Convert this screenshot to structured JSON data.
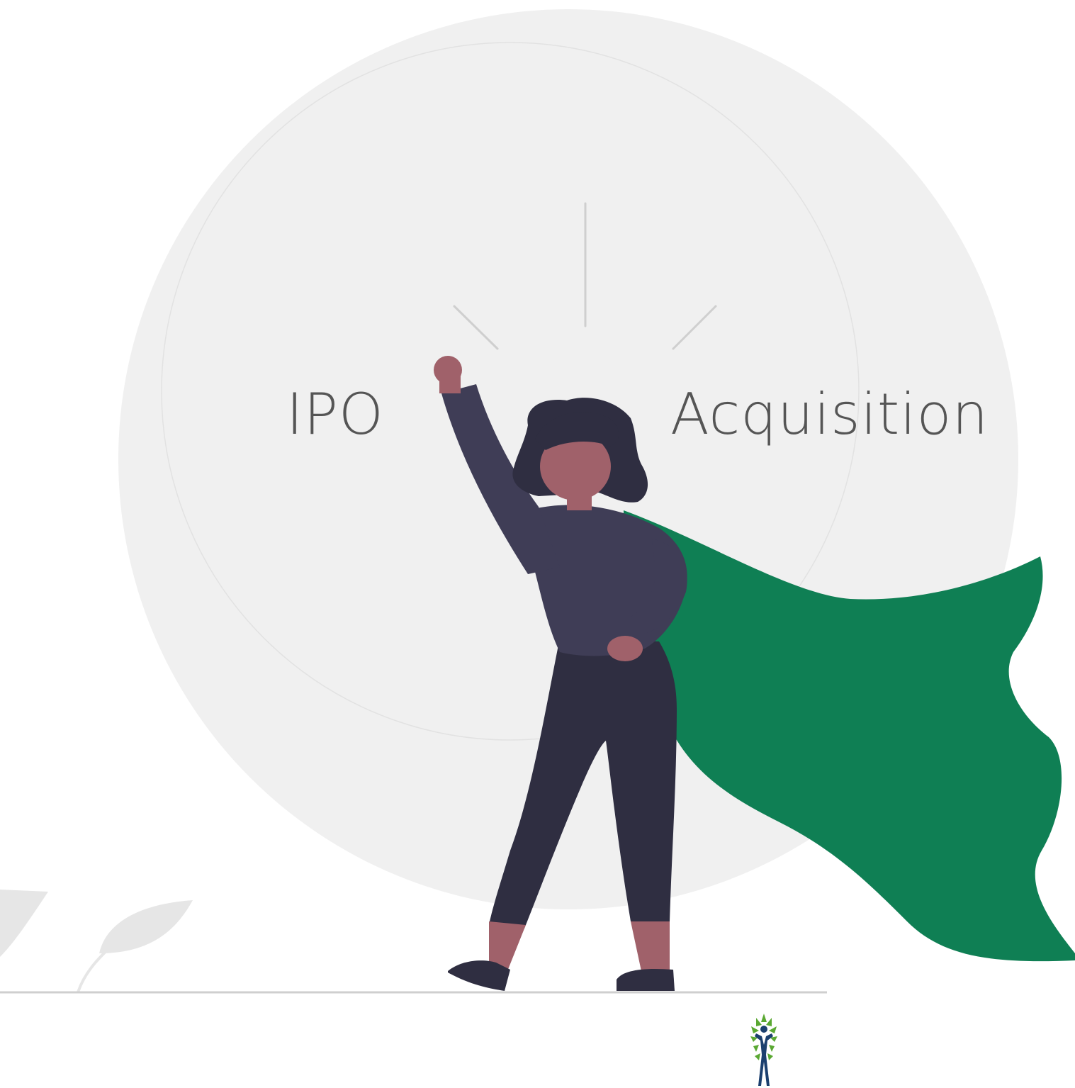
{
  "labels": {
    "left": "IPO",
    "right": "Acquisition"
  },
  "colors": {
    "background": "#ffffff",
    "big_circle": "#f0f0f0",
    "inner_circle_outline": "#e2e2e2",
    "sparkle_lines": "#cfcfcf",
    "label_text": "#555555",
    "cape": "#0f7f54",
    "skin": "#a0616a",
    "hair": "#2f2e41",
    "shirt": "#3f3d56",
    "pants": "#2f2e41",
    "ground": "#cfcfcf",
    "leaves": "#e6e6e6",
    "logo_green": "#5aa832",
    "logo_blue": "#1b3f6e"
  },
  "icons": {
    "figure": "superhero-woman-illustration",
    "leaves": "leaf-plant-icon",
    "logo": "tree-person-logo-icon"
  }
}
